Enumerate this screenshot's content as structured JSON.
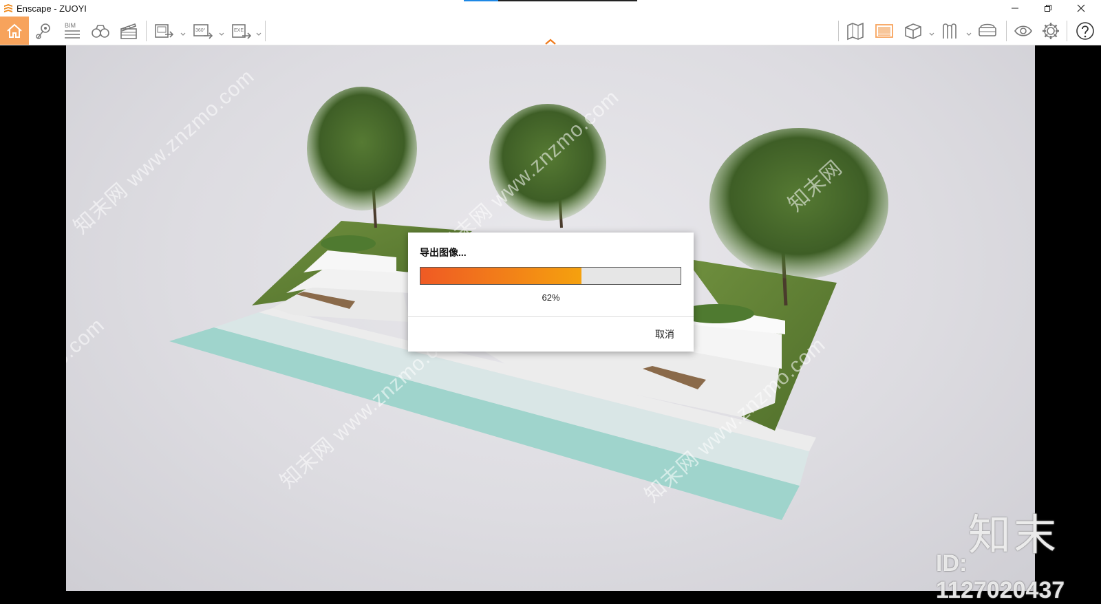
{
  "window": {
    "title": "Enscape - ZUOYI",
    "minimize_icon": "minimize-icon",
    "restore_icon": "restore-icon",
    "close_icon": "close-icon"
  },
  "toolbar": {
    "bim_label": "BIM",
    "pano_label": "360°",
    "exe_label": "EXE",
    "accent_color": "#f7a35c",
    "icons": [
      "home-icon",
      "location-pin-icon",
      "bim-icon",
      "binoculars-icon",
      "clapper-icon",
      "batch-render-icon",
      "panorama-export-icon",
      "exe-export-icon",
      "map-icon",
      "image-view-icon",
      "cube-icon",
      "material-icon",
      "vr-headset-icon",
      "eye-icon",
      "gear-icon",
      "help-icon"
    ]
  },
  "viewport": {
    "watermarks": [
      "知末网 www.znzmo.com",
      "知末网 www.znzmo.com",
      "znzmo.com",
      "知末网 www.znzmo.com",
      "知末网 www.znzmo.com",
      "知末网"
    ],
    "brand": "知末",
    "id_text": "ID: 1127020437"
  },
  "dialog": {
    "title": "导出图像...",
    "progress": 0.62,
    "progress_text": "62%",
    "cancel_label": "取消",
    "progress_start_color": "#ef5a24",
    "progress_end_color": "#f5a10e"
  }
}
